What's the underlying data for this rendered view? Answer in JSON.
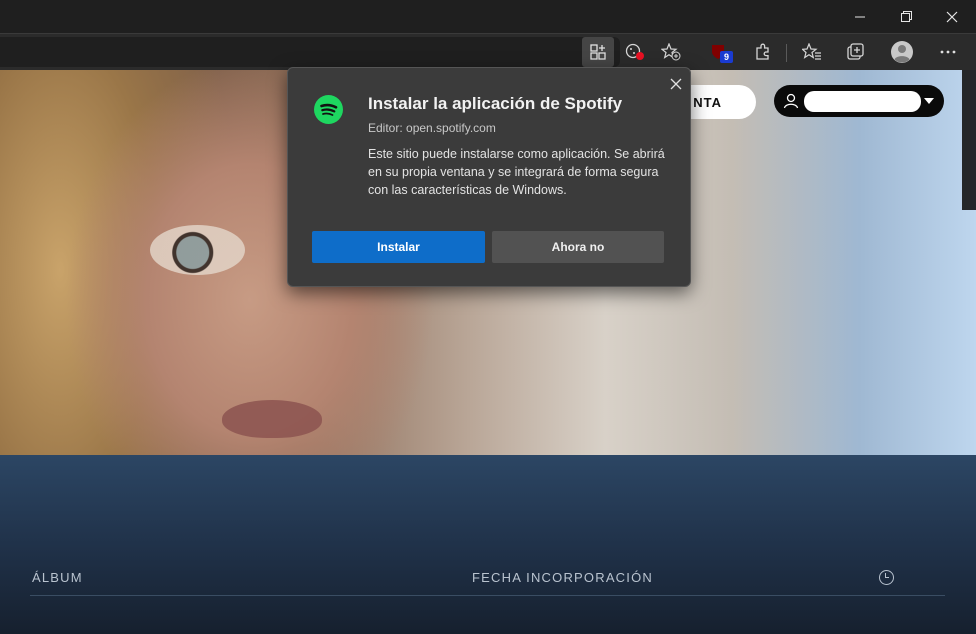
{
  "window": {
    "minimize_icon": "minimize-icon",
    "restore_icon": "restore-icon",
    "close_icon": "close-icon"
  },
  "toolbar": {
    "icons": [
      "app-available-icon",
      "tracking-prevention-icon",
      "add-favorite-icon",
      "ublock-extension-icon",
      "extensions-icon",
      "favorites-icon",
      "collections-icon",
      "profile-icon",
      "more-icon"
    ],
    "ublock_badge": "9"
  },
  "page": {
    "header_button_label": "NTA",
    "columns": {
      "album": "ÁLBUM",
      "date_added": "FECHA INCORPORACIÓN"
    }
  },
  "install_popup": {
    "title": "Instalar la aplicación de Spotify",
    "editor": "Editor: open.spotify.com",
    "description": "Este sitio puede instalarse como aplicación. Se abrirá en su propia ventana y se integrará de forma segura con las características de Windows.",
    "install_label": "Instalar",
    "later_label": "Ahora no"
  },
  "colors": {
    "accent_blue": "#0e6dc9",
    "spotify_green": "#1ed760",
    "popup_bg": "#3b3b3b"
  }
}
